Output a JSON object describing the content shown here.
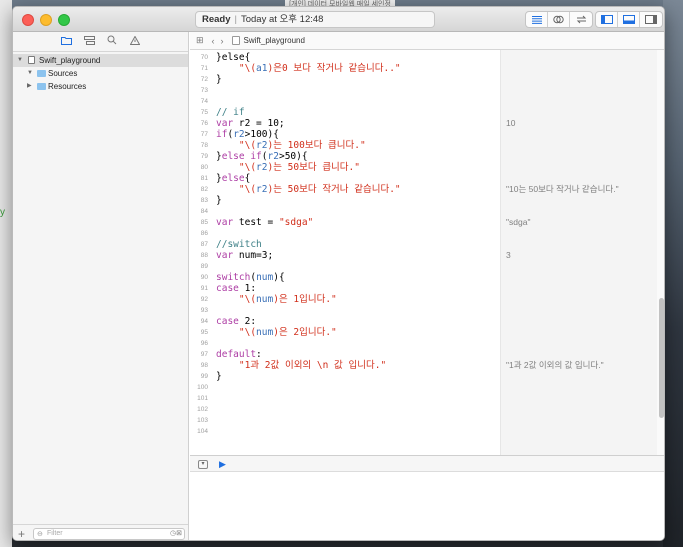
{
  "background_window_title": "[개인] 데이터 모바일웹 매일 세인정",
  "left_stray_text": "y",
  "titlebar": {
    "status_ready": "Ready",
    "status_separator": "|",
    "status_time": "Today at 오후 12:48",
    "buttons_right": [
      "align-left-icon",
      "link-circles-icon",
      "switch-arrows-icon",
      "panel-left-icon",
      "panel-bottom-icon",
      "panel-right-icon"
    ]
  },
  "navigator": {
    "tabs": [
      "folder-icon",
      "hierarchy-icon",
      "search-icon",
      "warning-icon"
    ],
    "tree": [
      {
        "label": "Swift_playground",
        "expanded": true,
        "selected": true
      },
      {
        "label": "Sources",
        "expanded": true
      },
      {
        "label": "Resources",
        "expanded": false
      }
    ],
    "filter_placeholder": "Filter",
    "add_label": "+"
  },
  "jumpbar": {
    "file": "Swift_playground"
  },
  "code_lines": [
    {
      "n": "70",
      "segs": [
        {
          "t": "}else{",
          "c": "pl"
        }
      ]
    },
    {
      "n": "71",
      "segs": [
        {
          "t": "    \"\\(",
          "c": "str"
        },
        {
          "t": "a1",
          "c": "interp"
        },
        {
          "t": ")은0 보다 작거나 같습니다..\"",
          "c": "str"
        }
      ]
    },
    {
      "n": "72",
      "segs": [
        {
          "t": "}",
          "c": "pl"
        }
      ]
    },
    {
      "n": "73",
      "segs": []
    },
    {
      "n": "74",
      "segs": []
    },
    {
      "n": "75",
      "segs": [
        {
          "t": "// if",
          "c": "cmt"
        }
      ]
    },
    {
      "n": "76",
      "segs": [
        {
          "t": "var",
          "c": "kw"
        },
        {
          "t": " r2 = 10;",
          "c": "pl"
        }
      ],
      "result": "10"
    },
    {
      "n": "77",
      "segs": [
        {
          "t": "if",
          "c": "kw"
        },
        {
          "t": "(",
          "c": "pl"
        },
        {
          "t": "r2",
          "c": "interp"
        },
        {
          "t": ">100){",
          "c": "pl"
        }
      ]
    },
    {
      "n": "78",
      "segs": [
        {
          "t": "    \"\\(",
          "c": "str"
        },
        {
          "t": "r2",
          "c": "interp"
        },
        {
          "t": ")는 100보다 큽니다.\"",
          "c": "str"
        }
      ]
    },
    {
      "n": "79",
      "segs": [
        {
          "t": "}",
          "c": "pl"
        },
        {
          "t": "else if",
          "c": "kw"
        },
        {
          "t": "(",
          "c": "pl"
        },
        {
          "t": "r2",
          "c": "interp"
        },
        {
          "t": ">50){",
          "c": "pl"
        }
      ]
    },
    {
      "n": "80",
      "segs": [
        {
          "t": "    \"\\(",
          "c": "str"
        },
        {
          "t": "r2",
          "c": "interp"
        },
        {
          "t": ")는 50보다 큽니다.\"",
          "c": "str"
        }
      ]
    },
    {
      "n": "81",
      "segs": [
        {
          "t": "}",
          "c": "pl"
        },
        {
          "t": "else",
          "c": "kw"
        },
        {
          "t": "{",
          "c": "pl"
        }
      ]
    },
    {
      "n": "82",
      "segs": [
        {
          "t": "    \"\\(",
          "c": "str"
        },
        {
          "t": "r2",
          "c": "interp"
        },
        {
          "t": ")는 50보다 작거나 같습니다.\"",
          "c": "str"
        }
      ],
      "result": "\"10는 50보다 작거나 같습니다.\""
    },
    {
      "n": "83",
      "segs": [
        {
          "t": "}",
          "c": "pl"
        }
      ]
    },
    {
      "n": "84",
      "segs": []
    },
    {
      "n": "85",
      "segs": [
        {
          "t": "var",
          "c": "kw"
        },
        {
          "t": " test = ",
          "c": "pl"
        },
        {
          "t": "\"sdga\"",
          "c": "str"
        }
      ],
      "result": "\"sdga\""
    },
    {
      "n": "86",
      "segs": []
    },
    {
      "n": "87",
      "segs": [
        {
          "t": "//switch",
          "c": "cmt"
        }
      ]
    },
    {
      "n": "88",
      "segs": [
        {
          "t": "var",
          "c": "kw"
        },
        {
          "t": " num=3;",
          "c": "pl"
        }
      ],
      "result": "3"
    },
    {
      "n": "89",
      "segs": []
    },
    {
      "n": "90",
      "segs": [
        {
          "t": "switch",
          "c": "kw"
        },
        {
          "t": "(",
          "c": "pl"
        },
        {
          "t": "num",
          "c": "interp"
        },
        {
          "t": "){",
          "c": "pl"
        }
      ]
    },
    {
      "n": "91",
      "segs": [
        {
          "t": "case",
          "c": "kw"
        },
        {
          "t": " 1:",
          "c": "pl"
        }
      ]
    },
    {
      "n": "92",
      "segs": [
        {
          "t": "    \"\\(",
          "c": "str"
        },
        {
          "t": "num",
          "c": "interp"
        },
        {
          "t": ")은 1입니다.\"",
          "c": "str"
        }
      ]
    },
    {
      "n": "93",
      "segs": []
    },
    {
      "n": "94",
      "segs": [
        {
          "t": "case",
          "c": "kw"
        },
        {
          "t": " 2:",
          "c": "pl"
        }
      ]
    },
    {
      "n": "95",
      "segs": [
        {
          "t": "    \"\\(",
          "c": "str"
        },
        {
          "t": "num",
          "c": "interp"
        },
        {
          "t": ")은 2입니다.\"",
          "c": "str"
        }
      ]
    },
    {
      "n": "96",
      "segs": []
    },
    {
      "n": "97",
      "segs": [
        {
          "t": "default",
          "c": "kw"
        },
        {
          "t": ":",
          "c": "pl"
        }
      ]
    },
    {
      "n": "98",
      "segs": [
        {
          "t": "    \"1과 2값 이외의 \\n 값 입니다.\"",
          "c": "str"
        }
      ],
      "result": "\"1과 2값 이외의 값 입니다.\""
    },
    {
      "n": "99",
      "segs": [
        {
          "t": "}",
          "c": "pl"
        }
      ]
    },
    {
      "n": "100",
      "segs": []
    },
    {
      "n": "101",
      "segs": []
    },
    {
      "n": "102",
      "segs": []
    },
    {
      "n": "103",
      "segs": []
    },
    {
      "n": "104",
      "segs": []
    }
  ],
  "colors": {
    "keyword": "#ad3da4",
    "string": "#d12f1b",
    "comment": "#3e8087",
    "identifier": "#3a6fb6",
    "accent": "#1f6fe0"
  }
}
